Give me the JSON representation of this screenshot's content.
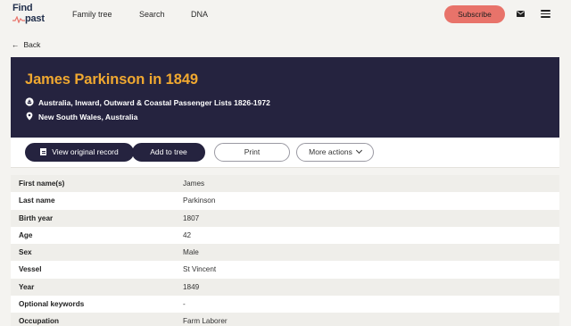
{
  "nav": {
    "logo_line1": "Find",
    "logo_line2": "past",
    "links": [
      "Family tree",
      "Search",
      "DNA"
    ],
    "subscribe_label": "Subscribe",
    "mail_icon": "mail-icon",
    "menu_icon": "hamburger-menu-icon"
  },
  "back_label": "Back",
  "record": {
    "title": "James Parkinson in 1849",
    "collection": "Australia, Inward, Outward & Coastal Passenger Lists 1826-1972",
    "location": "New South Wales, Australia"
  },
  "actions": {
    "view_original": "View original record",
    "add_to_tree": "Add to tree",
    "print": "Print",
    "more_actions": "More actions"
  },
  "fields": [
    {
      "label": "First name(s)",
      "value": "James"
    },
    {
      "label": "Last name",
      "value": "Parkinson"
    },
    {
      "label": "Birth year",
      "value": "1807"
    },
    {
      "label": "Age",
      "value": "42"
    },
    {
      "label": "Sex",
      "value": "Male"
    },
    {
      "label": "Vessel",
      "value": "St Vincent"
    },
    {
      "label": "Year",
      "value": "1849"
    },
    {
      "label": "Optional keywords",
      "value": "-"
    },
    {
      "label": "Occupation",
      "value": "Farm Laborer"
    }
  ],
  "colors": {
    "header_bg": "#25233f",
    "title": "#f0a830",
    "subscribe": "#e8736a",
    "page_bg": "#f4f3f0"
  }
}
